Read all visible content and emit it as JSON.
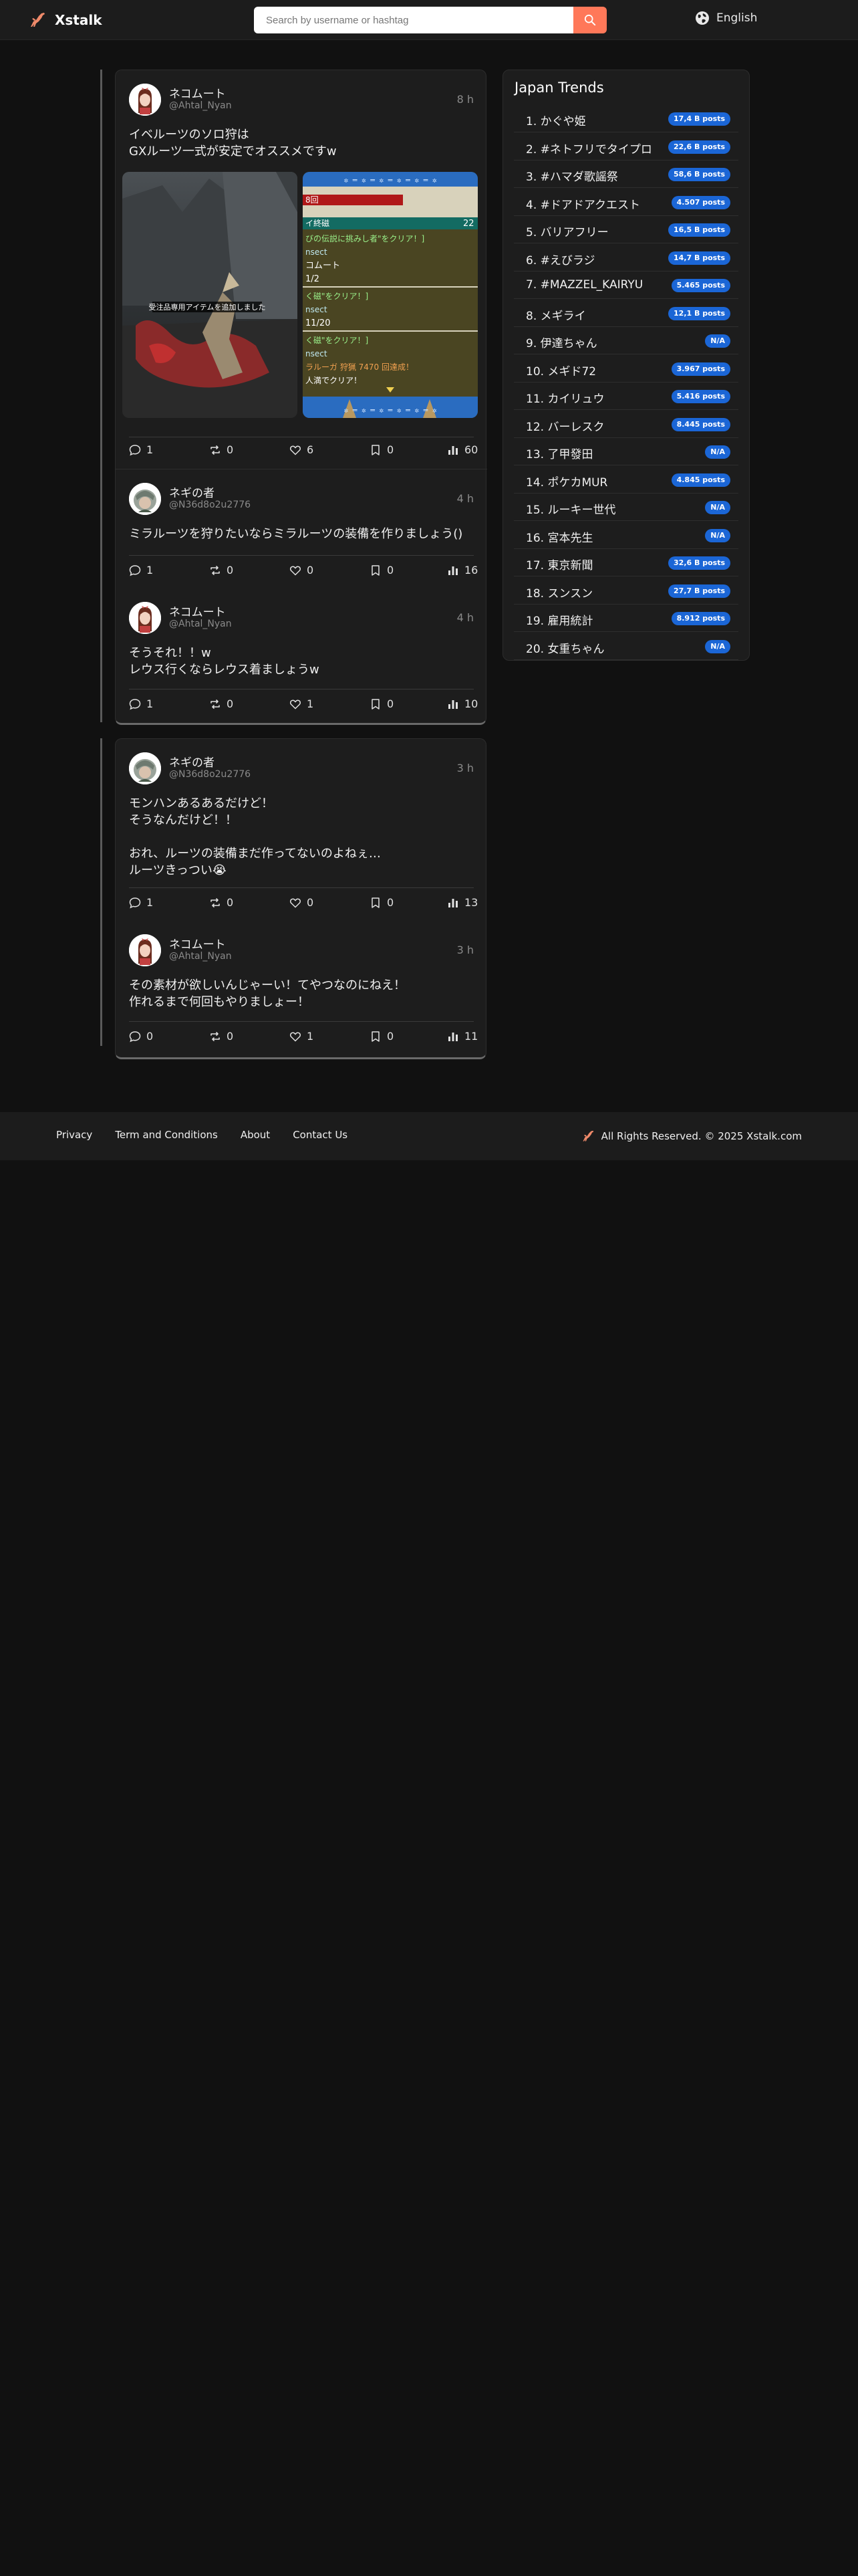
{
  "header": {
    "app_name": "Xstalk",
    "search_placeholder": "Search by username or hashtag",
    "language": "English",
    "accent": "#ff7859"
  },
  "threads": [
    {
      "posts": [
        {
          "name": "ネコムート",
          "handle": "@Ahtal_Nyan",
          "time": "8 h",
          "text": "イベルーツのソロ狩は\nGXルーツ一式が安定でオススメですw",
          "image_caption": "受注品専用アイテムを追加しました",
          "image2_lines": [
            "8回",
            "イ終磁",
            "22",
            "びの伝説に挑みし者\"をクリア！]",
            "nsect",
            "コムート",
            "1/2",
            "く磁\"をクリア！]",
            "nsect",
            "11/20",
            "く磁\"をクリア！]",
            "nsect",
            "ラルーガ 狩猟 7470 回達成！",
            "人満でクリア！"
          ],
          "replies": "1",
          "reposts": "0",
          "likes": "6",
          "bookmarks": "0",
          "views": "60"
        },
        {
          "name": "ネギの者",
          "handle": "@N36d8o2u2776",
          "time": "4 h",
          "text": "ミラルーツを狩りたいならミラルーツの装備を作りましょう()",
          "replies": "1",
          "reposts": "0",
          "likes": "0",
          "bookmarks": "0",
          "views": "16"
        },
        {
          "name": "ネコムート",
          "handle": "@Ahtal_Nyan",
          "time": "4 h",
          "text": "そうそれ！！w\nレウス行くならレウス着ましょうw",
          "replies": "1",
          "reposts": "0",
          "likes": "1",
          "bookmarks": "0",
          "views": "10"
        }
      ]
    },
    {
      "posts": [
        {
          "name": "ネギの者",
          "handle": "@N36d8o2u2776",
          "time": "3 h",
          "text": "モンハンあるあるだけど！\nそうなんだけど！！\n\nおれ、ルーツの装備まだ作ってないのよねぇ…\nルーツきっつい😭",
          "replies": "1",
          "reposts": "0",
          "likes": "0",
          "bookmarks": "0",
          "views": "13"
        },
        {
          "name": "ネコムート",
          "handle": "@Ahtal_Nyan",
          "time": "3 h",
          "text": "その素材が欲しいんじゃーい！てやつなのにねえ！\n作れるまで何回もやりましょー！",
          "replies": "0",
          "reposts": "0",
          "likes": "1",
          "bookmarks": "0",
          "views": "11"
        }
      ]
    }
  ],
  "trends": {
    "title": "Japan Trends",
    "badge_color": "#1b66d6",
    "items": [
      {
        "label": "1. かぐや姫",
        "count": "17,4 B posts"
      },
      {
        "label": "2. #ネトフリでタイプロ",
        "count": "22,6 B posts"
      },
      {
        "label": "3. #ハマダ歌謡祭",
        "count": "58,6 B posts"
      },
      {
        "label": "4. #ドアドアクエスト",
        "count": "4.507 posts"
      },
      {
        "label": "5. バリアフリー",
        "count": "16,5 B posts"
      },
      {
        "label": "6. #えびラジ",
        "count": "14,7 B posts"
      },
      {
        "label": "7. #MAZZEL_KAIRYU",
        "count": "5.465 posts"
      },
      {
        "label": "8. メギライ",
        "count": "12,1 B posts"
      },
      {
        "label": "9. 伊達ちゃん",
        "count": "N/A"
      },
      {
        "label": "10. メギド72",
        "count": "3.967 posts"
      },
      {
        "label": "11. カイリュウ",
        "count": "5.416 posts"
      },
      {
        "label": "12. バーレスク",
        "count": "8.445 posts"
      },
      {
        "label": "13. 了甲發田",
        "count": "N/A"
      },
      {
        "label": "14. ポケカMUR",
        "count": "4.845 posts"
      },
      {
        "label": "15. ルーキー世代",
        "count": "N/A"
      },
      {
        "label": "16. 宮本先生",
        "count": "N/A"
      },
      {
        "label": "17. 東京新聞",
        "count": "32,6 B posts"
      },
      {
        "label": "18. スンスン",
        "count": "27,7 B posts"
      },
      {
        "label": "19. 雇用統計",
        "count": "8.912 posts"
      },
      {
        "label": "20. 女重ちゃん",
        "count": "N/A"
      }
    ]
  },
  "footer": {
    "links": [
      "Privacy",
      "Term and Conditions",
      "About",
      "Contact Us"
    ],
    "copyright": "All Rights Reserved. © 2025 Xstalk.com"
  }
}
